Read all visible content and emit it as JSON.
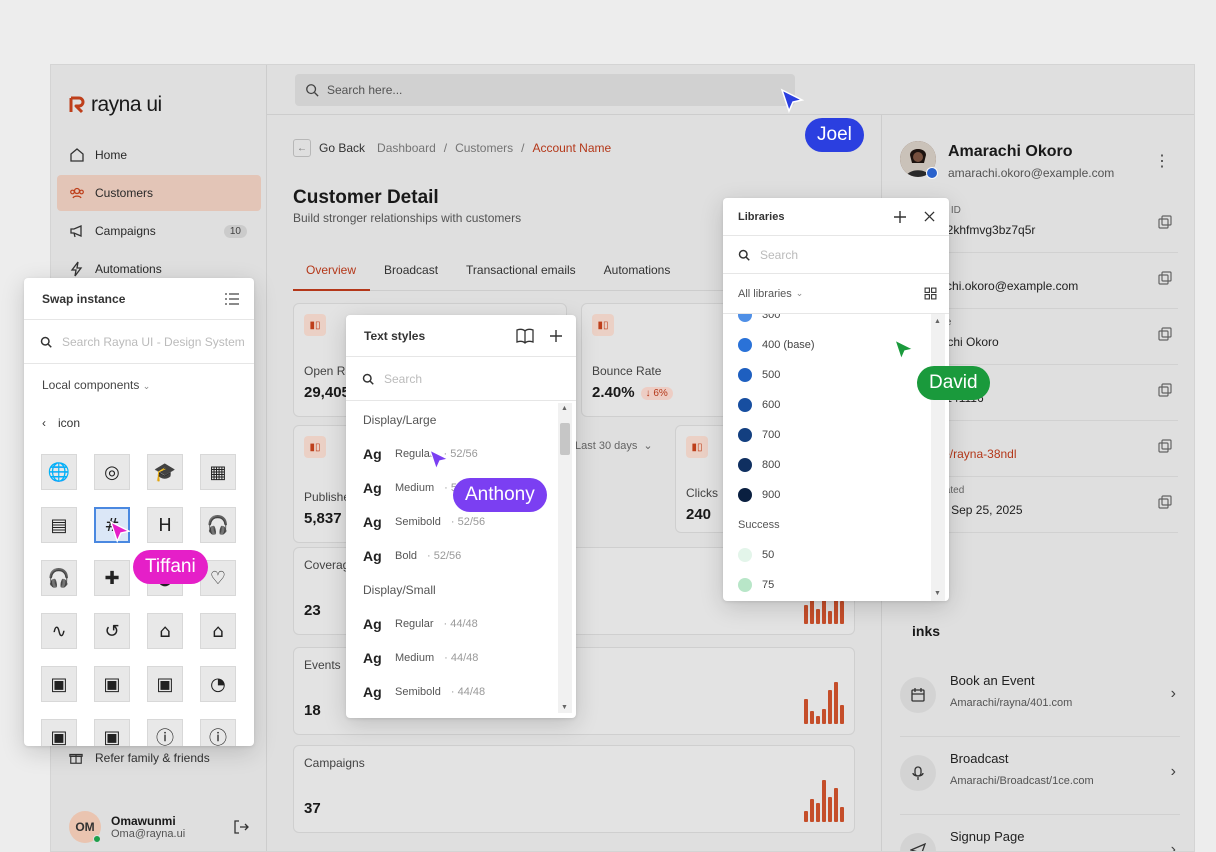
{
  "brand": {
    "name": "rayna ui",
    "accent": "#c2411c"
  },
  "sidebar": {
    "items": [
      {
        "label": "Home",
        "icon": "home-icon"
      },
      {
        "label": "Customers",
        "icon": "users-icon",
        "active": true
      },
      {
        "label": "Campaigns",
        "icon": "megaphone-icon",
        "badge": "10"
      },
      {
        "label": "Automations",
        "icon": "bolt-icon"
      }
    ],
    "refer_label": "Refer family & friends",
    "user": {
      "initials": "OM",
      "name": "Omawunmi",
      "email": "Oma@rayna.ui"
    }
  },
  "topbar": {
    "search_placeholder": "Search here..."
  },
  "breadcrumb": {
    "back": "Go Back",
    "items": [
      "Dashboard",
      "Customers"
    ],
    "current": "Account Name"
  },
  "page": {
    "title": "Customer Detail",
    "subtitle": "Build stronger relationships with customers",
    "tabs": [
      "Overview",
      "Broadcast",
      "Transactional emails",
      "Automations"
    ]
  },
  "stats": {
    "open_rate": {
      "label": "Open Ra",
      "value": "29,405"
    },
    "bounce_rate": {
      "label": "Bounce Rate",
      "value": "2.40%",
      "delta": "↓ 6%"
    },
    "published": {
      "label": "Publishe",
      "value": "5,837"
    },
    "clicks": {
      "label": "Clicks",
      "value": "240"
    },
    "period": "Last 30 days"
  },
  "summary": [
    {
      "label": "Coverag",
      "value": "23",
      "bars": [
        0.45,
        0.8,
        0.35,
        0.6,
        0.3,
        1.0,
        0.55
      ]
    },
    {
      "label": "Events",
      "value": "18",
      "bars": [
        0.6,
        0.3,
        0.2,
        0.35,
        0.8,
        1.0,
        0.45
      ]
    },
    {
      "label": "Campaigns",
      "value": "37",
      "bars": [
        0.25,
        0.55,
        0.45,
        1.0,
        0.6,
        0.8,
        0.35
      ]
    }
  ],
  "profile": {
    "name": "Amarachi Okoro",
    "email": "amarachi.okoro@example.com",
    "fields": [
      {
        "label": "ustomer ID",
        "value": "CUS_i2khfmvg3bz7q5r"
      },
      {
        "label": "mails",
        "value": "amarachi.okoro@example.com"
      },
      {
        "label": "ull Name",
        "value": "Amarachi Okoro"
      },
      {
        "label": "mber",
        "value": "08168141116"
      },
      {
        "label": "RL",
        "value": "affiliate/rayna-38ndl",
        "link": true
      },
      {
        "label": "ate Created",
        "value": "Friday, Sep 25, 2025"
      }
    ],
    "links_title": "inks",
    "links": [
      {
        "title": "Book an Event",
        "url": "Amarachi/rayna/401.com",
        "icon": "calendar-icon"
      },
      {
        "title": "Broadcast",
        "url": "Amarachi/Broadcast/1ce.com",
        "icon": "microphone-icon"
      },
      {
        "title": "Signup Page",
        "url": "Amarachi/signup/rayna.com",
        "icon": "send-icon"
      }
    ]
  },
  "swap_panel": {
    "title": "Swap instance",
    "search_placeholder": "Search Rayna UI - Design System",
    "filter": "Local components",
    "back_label": "icon",
    "icons": [
      "globe-icon",
      "target-icon",
      "graduation-cap-icon",
      "grid-icon",
      "layout-icon",
      "hashtag-icon",
      "heading-icon",
      "headphones-icon",
      "headset-icon",
      "puzzle-icon",
      "heart-shield-icon",
      "heart-check-icon",
      "activity-icon",
      "history-icon",
      "home-icon",
      "home-alt-icon",
      "image-icon",
      "image-add-icon",
      "image-edit-icon",
      "image-disabled-icon",
      "image-check-icon",
      "image-plus-icon",
      "info-circle-icon",
      "info-hexagon-icon"
    ],
    "glyphs": [
      "🌐",
      "◎",
      "🎓",
      "▦",
      "▤",
      "#",
      "H",
      "🎧",
      "🎧",
      "✚",
      "◒",
      "♡",
      "∿",
      "↺",
      "⌂",
      "⌂",
      "▣",
      "▣",
      "▣",
      "◔",
      "▣",
      "▣",
      "ⓘ",
      "ⓘ"
    ],
    "selected": 5
  },
  "text_styles": {
    "title": "Text styles",
    "search_placeholder": "Search",
    "rows": [
      {
        "kind": "group",
        "label": "Display/Large"
      },
      {
        "kind": "style",
        "name": "Regular",
        "meta": "· 52/56"
      },
      {
        "kind": "style",
        "name": "Medium",
        "meta": "· 52/56"
      },
      {
        "kind": "style",
        "name": "Semibold",
        "meta": "· 52/56"
      },
      {
        "kind": "style",
        "name": "Bold",
        "meta": "· 52/56"
      },
      {
        "kind": "group",
        "label": "Display/Small"
      },
      {
        "kind": "style",
        "name": "Regular",
        "meta": "· 44/48"
      },
      {
        "kind": "style",
        "name": "Medium",
        "meta": "· 44/48"
      },
      {
        "kind": "style",
        "name": "Semibold",
        "meta": "· 44/48"
      }
    ]
  },
  "libraries": {
    "title": "Libraries",
    "search_placeholder": "Search",
    "filter": "All libraries",
    "rows": [
      {
        "kind": "swatch",
        "label": "300",
        "color": "#4f8fe6"
      },
      {
        "kind": "swatch",
        "label": "400 (base)",
        "color": "#2a72d8"
      },
      {
        "kind": "swatch",
        "label": "500",
        "color": "#1e5fc0"
      },
      {
        "kind": "swatch",
        "label": "600",
        "color": "#174ea0"
      },
      {
        "kind": "swatch",
        "label": "700",
        "color": "#133f80"
      },
      {
        "kind": "swatch",
        "label": "800",
        "color": "#0f2f60"
      },
      {
        "kind": "swatch",
        "label": "900",
        "color": "#0a1f40"
      },
      {
        "kind": "section",
        "label": "Success"
      },
      {
        "kind": "swatch",
        "label": "50",
        "color": "#e3f5ea"
      },
      {
        "kind": "swatch",
        "label": "75",
        "color": "#b8e6c8"
      }
    ]
  },
  "collaborators": [
    {
      "name": "Joel",
      "color": "#2b3fe0"
    },
    {
      "name": "David",
      "color": "#1a9a3c"
    },
    {
      "name": "Anthony",
      "color": "#7b3ff2"
    },
    {
      "name": "Tiffani",
      "color": "#e51fc8"
    }
  ]
}
